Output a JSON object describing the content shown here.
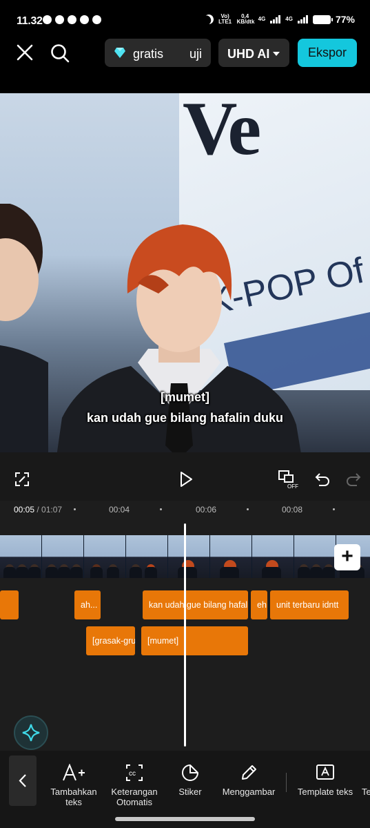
{
  "status_bar": {
    "time": "11.32",
    "network_vo": "Vo) LTE1",
    "speed": "0,4 KB/dtk",
    "net1": "4G",
    "net2": "4G",
    "battery_pct": "77%"
  },
  "toolbar": {
    "free_label": "gratis",
    "free_label2": "uji",
    "resolution": "UHD AI",
    "export_label": "Ekspor"
  },
  "preview": {
    "background_sign_text": "Ve",
    "sign_line2": "K-POP Of",
    "subtitle_top": "[mumet]",
    "subtitle_bottom": "kan udah gue bilang hafalin duku"
  },
  "playback": {
    "proxy_badge": "OFF"
  },
  "timeline": {
    "current_time": "00:05",
    "total_time": "01:07",
    "ticks": [
      "00:04",
      "00:06",
      "00:08"
    ],
    "text_track1": [
      "",
      "ah...",
      "kan udah gue bilang hafalin duku",
      "eh..",
      "unit terbaru idntt"
    ],
    "text_track2": [
      "[grasak-grusuk]",
      "[mumet]"
    ]
  },
  "bottom_menu": {
    "items": [
      "Tambahkan teks",
      "Keterangan Otomatis",
      "Stiker",
      "Menggambar",
      "Template teks",
      "Te"
    ]
  },
  "colors": {
    "accent": "#14c7dd",
    "clip": "#e87708",
    "background": "#1d1d1d"
  }
}
